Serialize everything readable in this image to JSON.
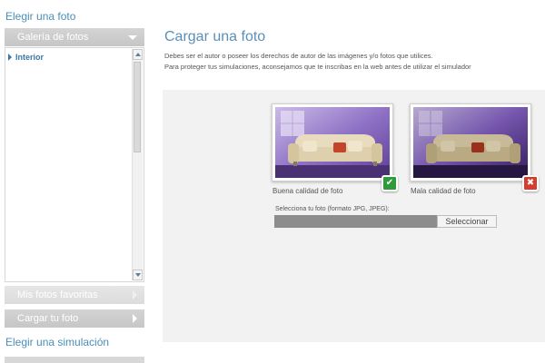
{
  "sidebar": {
    "heading_photo": "Elegir una foto",
    "gallery_label": "Galería de fotos",
    "gallery_items": [
      "Interior"
    ],
    "favorites_label": "Mis fotos favoritas",
    "upload_label": "Cargar tu foto",
    "heading_simulation": "Elegir una simulación"
  },
  "main": {
    "title": "Cargar una foto",
    "intro_line1": "Debes ser el autor o poseer los derechos de autor de las imágenes y/o fotos que utilices.",
    "intro_line2": "Para proteger tus simulaciones, aconsejamos que te inscribas en la web antes de utilizar el simulador",
    "good_caption": "Buena calidad de foto",
    "bad_caption": "Mala calidad de foto",
    "good_icon": "checkmark-icon",
    "bad_icon": "cross-icon",
    "file_label": "Selecciona tu foto (formato JPG, JPEG):",
    "select_button": "Seleccionar"
  },
  "colors": {
    "accent": "#4a8fb8",
    "good": "#2e9a3a",
    "bad": "#d63b2f"
  }
}
